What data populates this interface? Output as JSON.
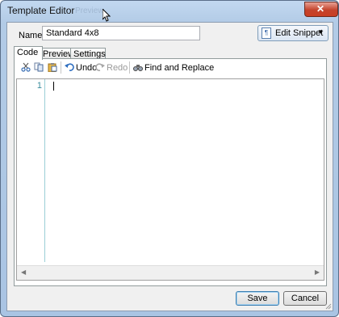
{
  "window": {
    "title": "Template Editor",
    "title_ghost": "Preview",
    "close_glyph": "✕"
  },
  "name_field": {
    "label": "Name:",
    "value": "Standard 4x8"
  },
  "edit_snippet": {
    "label": "Edit Snippet",
    "icon": "snippet-icon"
  },
  "tabs": [
    {
      "label": "Code"
    },
    {
      "label": "Preview"
    },
    {
      "label": "Settings"
    }
  ],
  "toolbar": {
    "cut_icon": "scissors-icon",
    "copy_icon": "copy-icon",
    "paste_icon": "paste-icon",
    "undo_label": "Undo",
    "redo_label": "Redo",
    "find_label": "Find and Replace"
  },
  "editor": {
    "line_numbers": [
      "1"
    ],
    "content": ""
  },
  "buttons": {
    "save": "Save",
    "cancel": "Cancel"
  }
}
